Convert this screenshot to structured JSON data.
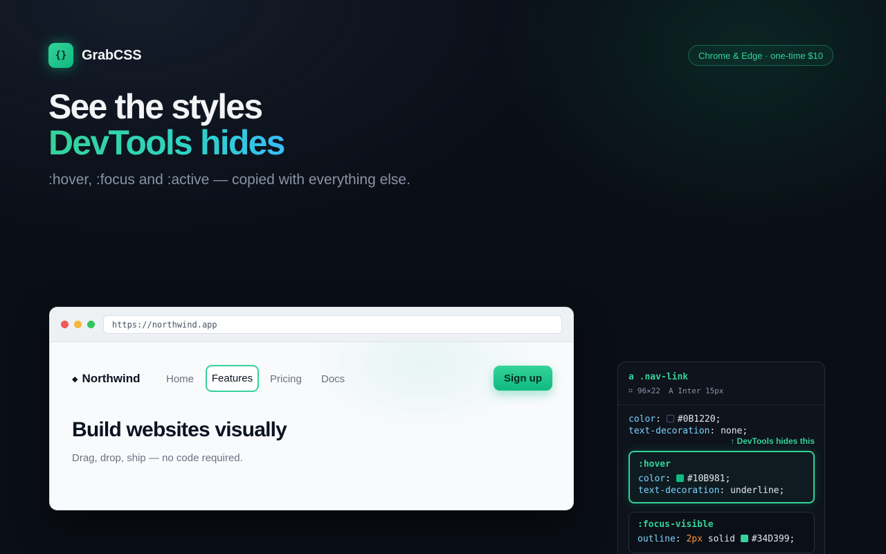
{
  "brand": {
    "logo_glyph": "{}",
    "name": "GrabCSS"
  },
  "badge": {
    "text": "Chrome & Edge · one-time $10"
  },
  "hero": {
    "line1": "See the styles",
    "line2": "DevTools hides",
    "subtitle": ":hover, :focus and :active — copied with everything else."
  },
  "browser": {
    "url": "https://northwind.app",
    "site": {
      "logo_icon": "◆",
      "logo": "Northwind",
      "nav": {
        "home": "Home",
        "features": "Features",
        "pricing": "Pricing",
        "docs": "Docs"
      },
      "signup": "Sign up",
      "title": "Build websites visually",
      "subtitle": "Drag, drop, ship — no code required."
    }
  },
  "inspector": {
    "selector": "a .nav-link",
    "size_icon": "crop-icon",
    "size": "96×22",
    "font_glyph": "A",
    "font": "Inter 15px",
    "base": {
      "color_prop": "color",
      "color_val": "#0B1220",
      "color_hex": "#0B1220",
      "td_prop": "text-decoration",
      "td_val": "none;"
    },
    "note": "↑ DevTools hides this",
    "hover": {
      "label": ":hover",
      "color_prop": "color",
      "color_val": "#10B981;",
      "color_hex": "#10B981",
      "td_prop": "text-decoration",
      "td_val": "underline;"
    },
    "focus": {
      "label": ":focus-visible",
      "outline_prop": "outline",
      "outline_width": "2px",
      "outline_style": "solid",
      "outline_color": "#34D399;",
      "outline_hex": "#34D399"
    }
  },
  "colors": {
    "accent": "#10B981",
    "accent_light": "#34D399",
    "background": "#0A0E16"
  }
}
